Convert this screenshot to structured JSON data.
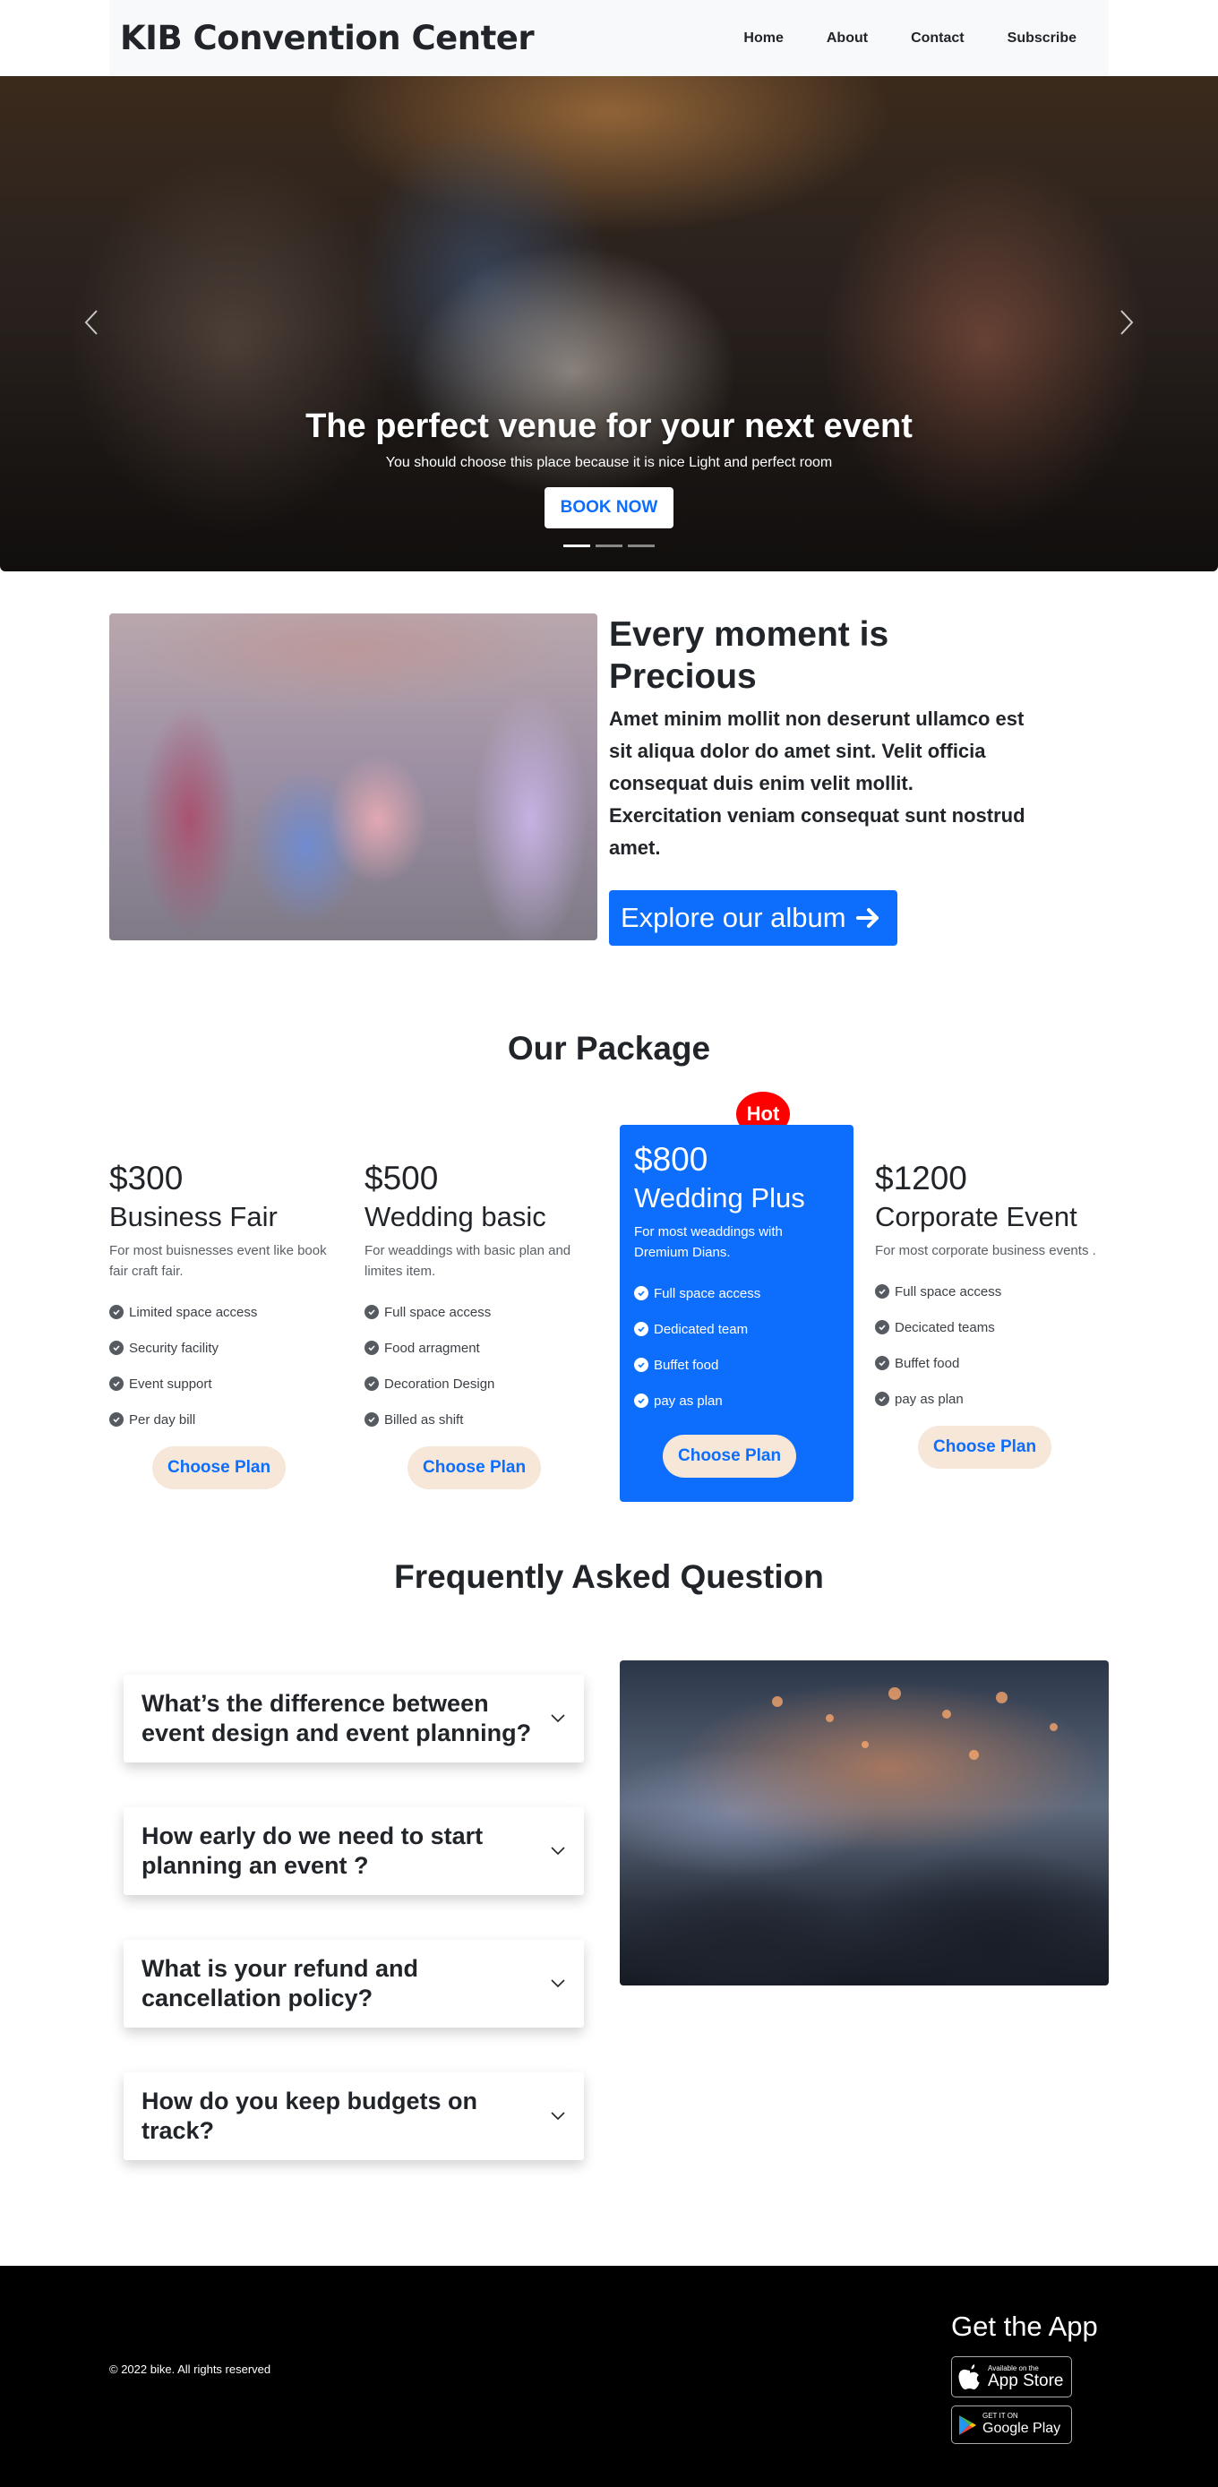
{
  "brand": "KIB Convention Center",
  "nav": [
    "Home",
    "About",
    "Contact",
    "Subscribe"
  ],
  "hero": {
    "title": "The perfect venue for your next event",
    "subtitle": "You should choose this place because it is nice Light and perfect room",
    "button": "BOOK NOW",
    "slides": 3,
    "active_slide": 1
  },
  "precious": {
    "title": "Every moment is Precious",
    "body": "Amet minim mollit non deserunt ullamco est sit aliqua dolor do amet sint. Velit officia consequat duis enim velit mollit. Exercitation veniam consequat sunt nostrud amet.",
    "button": "Explore our album",
    "button_icon": "arrow-right-icon"
  },
  "packages": {
    "title": "Our Package",
    "hot_label": "Hot",
    "items": [
      {
        "price": "$300",
        "name": "Business Fair",
        "desc": "For most buisnesses event like book fair craft fair.",
        "features": [
          "Limited space access",
          "Security facility",
          "Event support",
          "Per day bill"
        ],
        "button": "Choose Plan",
        "featured": false
      },
      {
        "price": "$500",
        "name": "Wedding basic",
        "desc": "For weaddings with basic plan and limites item.",
        "features": [
          "Full space access",
          "Food arragment",
          "Decoration Design",
          "Billed as shift"
        ],
        "button": "Choose Plan",
        "featured": false
      },
      {
        "price": "$800",
        "name": "Wedding Plus",
        "desc": "For most weaddings with Dremium Dians.",
        "features": [
          "Full space access",
          "Dedicated team",
          "Buffet food",
          "pay as plan"
        ],
        "button": "Choose Plan",
        "featured": true
      },
      {
        "price": "$1200",
        "name": "Corporate Event",
        "desc": "For most corporate business events .",
        "features": [
          "Full space access",
          "Decicated teams",
          "Buffet food",
          "pay as plan"
        ],
        "button": "Choose Plan",
        "featured": false
      }
    ]
  },
  "faq": {
    "title": "Frequently Asked Question",
    "items": [
      "What’s the difference between event design and event planning?",
      "How early do we need to start planning an event ?",
      "What is your refund and cancellation policy?",
      "How do you keep budgets on track?"
    ]
  },
  "footer": {
    "copyright": "© 2022 bike. All rights reserved",
    "get_app": "Get the App",
    "app_store_small": "Available on the",
    "app_store_big": "App Store",
    "google_play_small": "GET IT ON",
    "google_play_big": "Google Play"
  },
  "colors": {
    "primary": "#0d6efd",
    "hot": "#ff0000",
    "choose_btn_bg": "#f6e7d8",
    "footer_bg": "#000000",
    "navbar_bg": "#f8f9fa"
  }
}
